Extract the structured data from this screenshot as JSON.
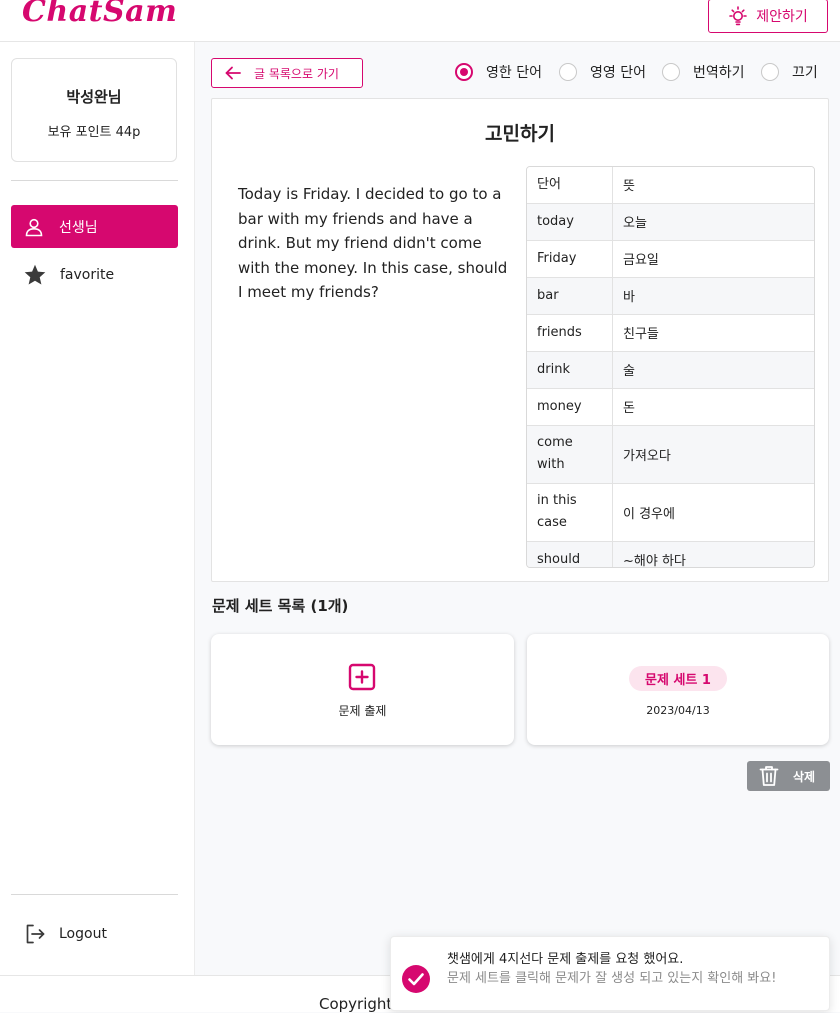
{
  "header": {
    "logo": "ChatSam",
    "suggest_label": "제안하기"
  },
  "sidebar": {
    "profile": {
      "name": "박성완님",
      "points": "보유 포인트 44p"
    },
    "nav": [
      {
        "label": "선생님",
        "active": true
      },
      {
        "label": "favorite",
        "active": false
      }
    ],
    "logout_label": "Logout"
  },
  "toolbar": {
    "back_label": "글 목록으로 가기",
    "modes": [
      {
        "label": "영한 단어",
        "checked": true
      },
      {
        "label": "영영 단어",
        "checked": false
      },
      {
        "label": "번역하기",
        "checked": false
      },
      {
        "label": "끄기",
        "checked": false
      }
    ]
  },
  "article": {
    "title": "고민하기",
    "body": "Today is Friday. I decided to go to a bar with my friends and have a drink. But my friend didn't come with the money. In this case, should I meet my friends?",
    "vocab_header": {
      "word": "단어",
      "meaning": "뜻"
    },
    "vocab": [
      {
        "word": "today",
        "meaning": "오늘"
      },
      {
        "word": "Friday",
        "meaning": "금요일"
      },
      {
        "word": "bar",
        "meaning": "바"
      },
      {
        "word": "friends",
        "meaning": "친구들"
      },
      {
        "word": "drink",
        "meaning": "술"
      },
      {
        "word": "money",
        "meaning": "돈"
      },
      {
        "word": "come with",
        "meaning": "가져오다"
      },
      {
        "word": "in this case",
        "meaning": "이 경우에"
      },
      {
        "word": "should",
        "meaning": "~해야 하다"
      }
    ]
  },
  "sets": {
    "title": "문제 세트 목록 (1개)",
    "create_label": "문제 출제",
    "items": [
      {
        "name": "문제 세트 1",
        "date": "2023/04/13"
      }
    ],
    "delete_label": "삭제"
  },
  "footer": {
    "copyright": "Copyright"
  },
  "toast": {
    "title": "챗샘에게 4지선다 문제 출제를 요청 했어요.",
    "description": "문제 세트를 클릭해 문제가 잘 생성 되고 있는지 확인해 봐요!"
  },
  "colors": {
    "accent": "#d6086f",
    "delete": "#8c8f93"
  }
}
